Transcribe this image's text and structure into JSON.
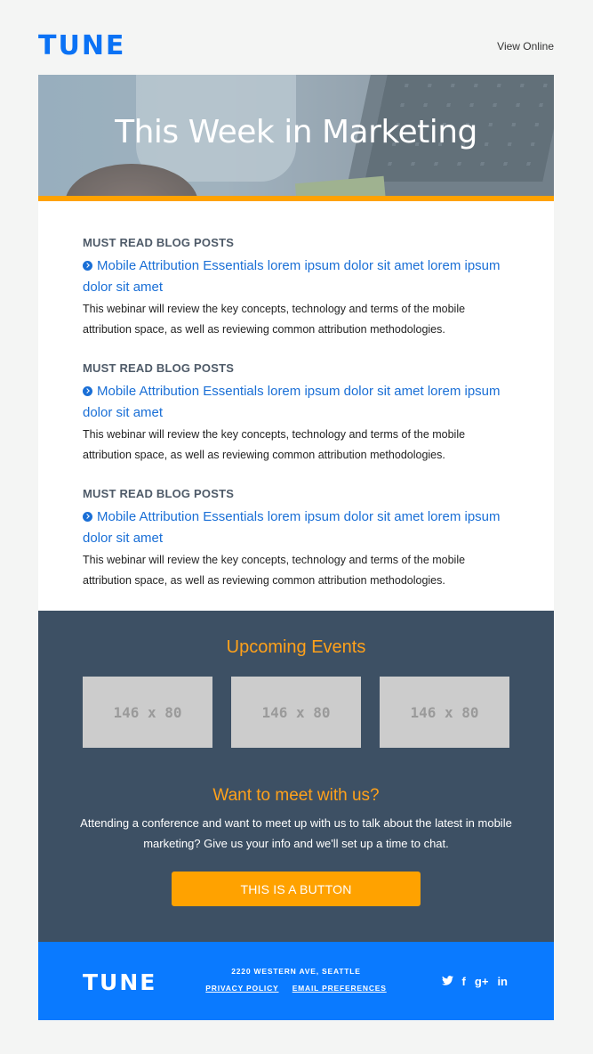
{
  "header": {
    "logo": "TUNE",
    "view_online": "View Online"
  },
  "hero": {
    "title": "This Week in Marketing"
  },
  "posts": [
    {
      "kicker": "MUST READ BLOG POSTS",
      "title": "Mobile Attribution Essentials lorem ipsum dolor sit amet lorem ipsum dolor sit amet",
      "description": "This webinar will review the key concepts, technology and terms of the mobile attribution space, as well as reviewing common attribution methodologies."
    },
    {
      "kicker": "MUST READ BLOG POSTS",
      "title": "Mobile Attribution Essentials lorem ipsum dolor sit amet lorem ipsum dolor sit amet",
      "description": "This webinar will review the key concepts, technology and terms of the mobile attribution space, as well as reviewing common attribution methodologies."
    },
    {
      "kicker": "MUST READ BLOG POSTS",
      "title": "Mobile Attribution Essentials lorem ipsum dolor sit amet lorem ipsum dolor sit amet",
      "description": "This webinar will review the key concepts, technology and terms of the mobile attribution space, as well as reviewing common attribution methodologies."
    }
  ],
  "events": {
    "heading": "Upcoming Events",
    "thumbnails": [
      "146 x 80",
      "146 x 80",
      "146 x 80"
    ],
    "meet_heading": "Want to meet with us?",
    "meet_text": "Attending a conference and want to meet up with us to talk about the latest in mobile marketing? Give us your info and we'll set up a time to chat.",
    "button_label": "THIS IS A BUTTON"
  },
  "footer": {
    "logo": "TUNE",
    "address": "2220 WESTERN AVE, SEATTLE",
    "privacy": "PRIVACY POLICY",
    "email_prefs": "EMAIL PREFERENCES",
    "social": [
      "twitter-icon",
      "facebook-icon",
      "google-plus-icon",
      "linkedin-icon"
    ]
  },
  "colors": {
    "brand_blue": "#0a72f5",
    "accent_orange": "#ffa200",
    "events_bg": "#3d5064",
    "link_blue": "#1a6fd6"
  }
}
